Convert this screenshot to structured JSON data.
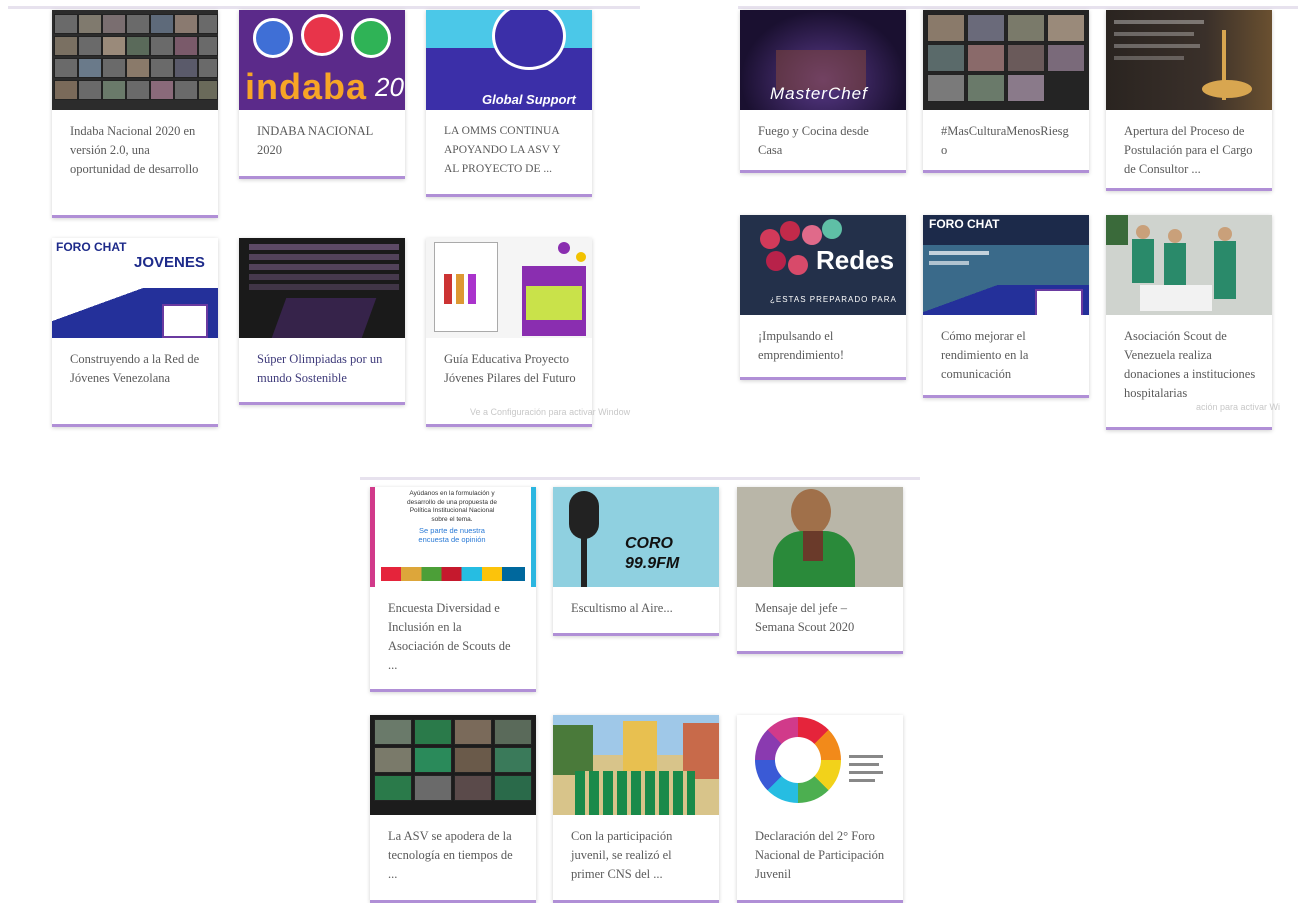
{
  "panels": [
    {
      "cards": [
        {
          "title": "Indaba Nacional 2020 en versión 2.0, una oportunidad de desarrollo"
        },
        {
          "title": "INDABA NACIONAL 2020",
          "thumb_text": "indaba",
          "thumb_year": "20"
        },
        {
          "title": "LA OMMS CONTINUA APOYANDO LA ASV Y AL PROYECTO DE ...",
          "thumb_text": "Global Support"
        },
        {
          "title": "Construyendo a la Red de Jóvenes Venezolana",
          "thumb_text": "FORO CHAT",
          "thumb_text2": "JOVENES"
        },
        {
          "title": "Súper Olimpiadas por un mundo Sostenible"
        },
        {
          "title": "Guía Educativa Proyecto Jóvenes Pilares del Futuro"
        }
      ],
      "watermark": "Ve a Configuración para activar Window"
    },
    {
      "cards": [
        {
          "title": "Fuego y Cocina desde Casa",
          "thumb_text": "MasterChef"
        },
        {
          "title": "#MasCulturaMenosRiesgo"
        },
        {
          "title": "Apertura del Proceso de Postulación para el Cargo de Consultor ..."
        },
        {
          "title": "¡Impulsando el emprendimiento!",
          "thumb_text": "Redes",
          "thumb_text2": "¿ESTAS PREPARADO PARA"
        },
        {
          "title": "Cómo mejorar el rendimiento en la comunicación",
          "thumb_text": "FORO CHAT"
        },
        {
          "title": "Asociación Scout de Venezuela realiza donaciones a instituciones hospitalarias"
        }
      ],
      "watermark": "ación para activar Wi"
    },
    {
      "cards": [
        {
          "title": "Encuesta Diversidad e Inclusión en la Asociación de Scouts de ...",
          "thumb_lines": [
            "Ayúdanos en la formulación y",
            "desarrollo de una propuesta de",
            "Política Institucional Nacional",
            "sobre el tema.",
            "Se parte de nuestra",
            "encuesta de opinión"
          ]
        },
        {
          "title": "Escultismo al Aire...",
          "thumb_text": "CORO",
          "thumb_text2": "99.9FM"
        },
        {
          "title": "Mensaje del jefe – Semana Scout 2020"
        },
        {
          "title": "La ASV se apodera de la tecnología en tiempos de ..."
        },
        {
          "title": "Con la participación juvenil, se realizó el primer CNS del ..."
        },
        {
          "title": "Declaración del 2° Foro Nacional de Participación Juvenil"
        }
      ]
    }
  ],
  "colors": {
    "accent_underline": "#b08fd6",
    "indaba_purple": "#5b2a8a",
    "global_support_blue": "#3b2fa8",
    "coro_blue": "#8fd0e0"
  }
}
